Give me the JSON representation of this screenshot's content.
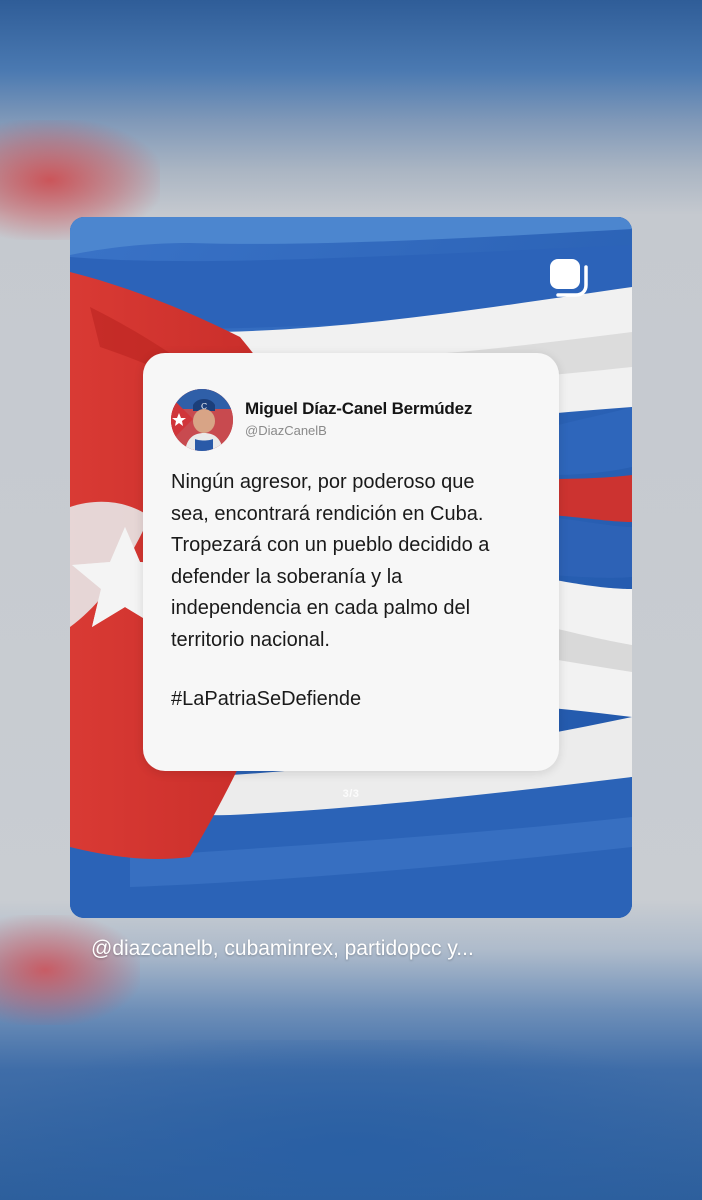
{
  "post": {
    "page_indicator": "3/3",
    "tweet": {
      "author_name": "Miguel Díaz-Canel Bermúdez",
      "author_handle": "@DiazCanelB",
      "text_lines": [
        "Ningún agresor, por poderoso que",
        "sea, encontrará rendición en Cuba.",
        "Tropezará con un pueblo decidido a",
        "defender la soberanía y la",
        "independencia en cada palmo del",
        "territorio nacional."
      ],
      "hashtag": "#LaPatriaSeDefiende"
    }
  },
  "caption": "@diazcanelb, cubaminrex, partidopcc y...",
  "icons": {
    "story": "layered-square-icon",
    "avatar": "profile-photo"
  },
  "colors": {
    "flag_red": "#d42f2a",
    "flag_blue": "#2a5fb8",
    "flag_white": "#f4f4f4",
    "card_background": "#f7f7f7"
  }
}
